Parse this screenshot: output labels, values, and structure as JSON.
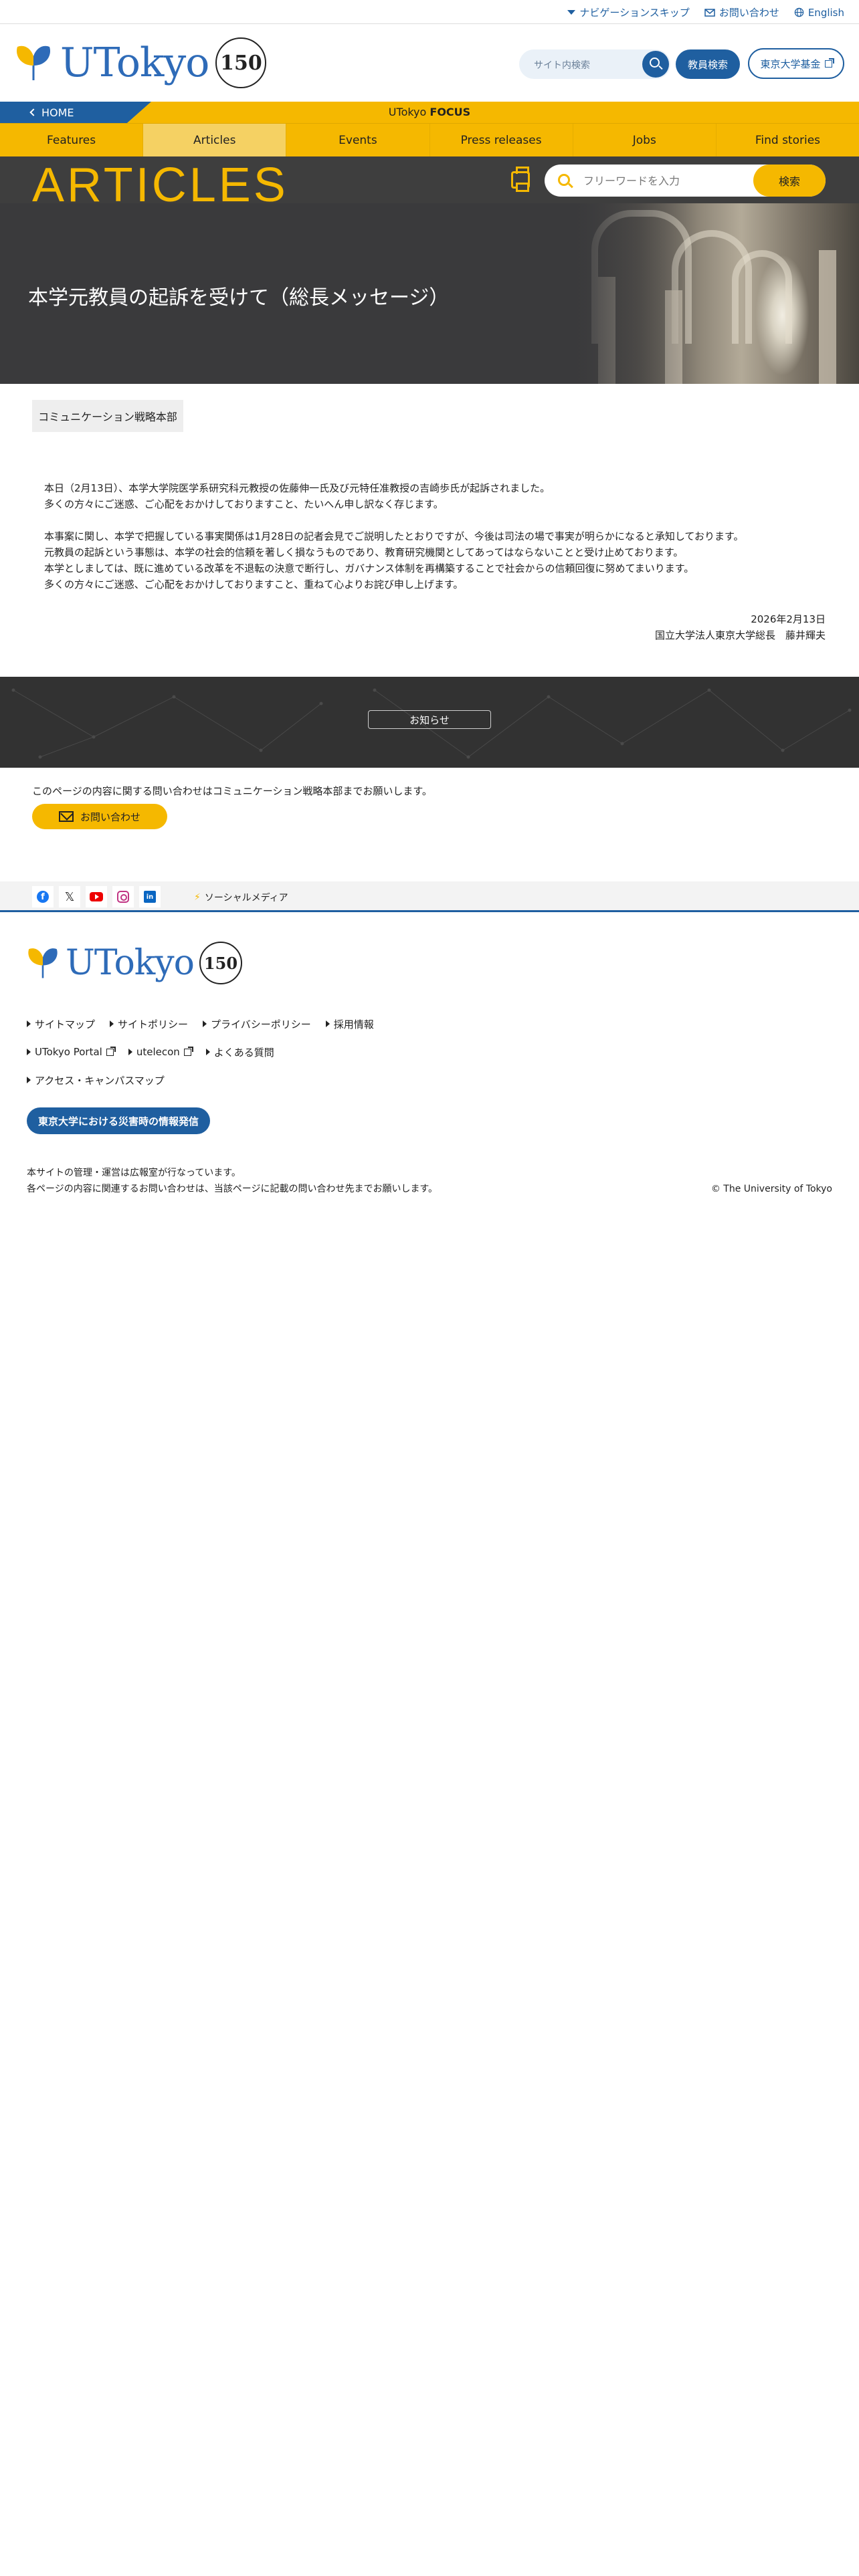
{
  "util": {
    "skip": "ナビゲーションスキップ",
    "contact": "お問い合わせ",
    "english": "English"
  },
  "header": {
    "logo_text": "UTokyo",
    "badge": "150",
    "site_search_placeholder": "サイト内検索",
    "staff_search": "教員検索",
    "fund": "東京大学基金"
  },
  "focus_bar": {
    "home": "HOME",
    "title_light": "UTokyo ",
    "title_bold": "FOCUS"
  },
  "nav": {
    "items": [
      "Features",
      "Articles",
      "Events",
      "Press releases",
      "Jobs",
      "Find stories"
    ],
    "active": "Articles"
  },
  "articles_bar": {
    "title": "ARTICLES",
    "keyword_placeholder": "フリーワードを入力",
    "search_button": "検索"
  },
  "hero": {
    "title": "本学元教員の起訴を受けて（総長メッセージ）"
  },
  "article": {
    "tag": "コミュニケーション戦略本部",
    "para1": [
      "本日（2月13日）、本学大学院医学系研究科元教授の佐藤伸一氏及び元特任准教授の吉崎歩氏が起訴されました。",
      "多くの方々にご迷惑、ご心配をおかけしておりますこと、たいへん申し訳なく存じます。"
    ],
    "para2": [
      "本事案に関し、本学で把握している事実関係は1月28日の記者会見でご説明したとおりですが、今後は司法の場で事実が明らかになると承知しております。",
      "元教員の起訴という事態は、本学の社会的信頼を著しく損なうものであり、教育研究機関としてあってはならないことと受け止めております。",
      "本学としましては、既に進めている改革を不退転の決意で断行し、ガバナンス体制を再構築することで社会からの信頼回復に努めてまいります。",
      "多くの方々にご迷惑、ご心配をおかけしておりますこと、重ねて心よりお詫び申し上げます。"
    ],
    "date": "2026年2月13日",
    "signature": "国立大学法人東京大学総長　藤井輝夫"
  },
  "notice": {
    "button": "お知らせ"
  },
  "contact": {
    "text": "このページの内容に関する問い合わせはコミュニケーション戦略本部までお願いします。",
    "button": "お問い合わせ"
  },
  "social": {
    "label": "ソーシャルメディア",
    "icons": [
      "facebook-icon",
      "x-icon",
      "youtube-icon",
      "instagram-icon",
      "linkedin-icon"
    ]
  },
  "footer": {
    "logo_text": "UTokyo",
    "badge": "150",
    "links_row1": [
      "サイトマップ",
      "サイトポリシー",
      "プライバシーポリシー",
      "採用情報"
    ],
    "links_row2": [
      "UTokyo Portal",
      "utelecon",
      "よくある質問"
    ],
    "links_row3": [
      "アクセス・キャンパスマップ"
    ],
    "disaster_button": "東京大学における災害時の情報発信",
    "note1": "本サイトの管理・運営は広報室が行なっています。",
    "note2": "各ページの内容に関連するお問い合わせは、当該ページに記載の問い合わせ先までお願いします。",
    "copyright": "© The University of Tokyo"
  },
  "colors": {
    "brand_blue": "#1f5fa0",
    "brand_yellow": "#f5b800",
    "dark_band": "#3e3e3e"
  }
}
